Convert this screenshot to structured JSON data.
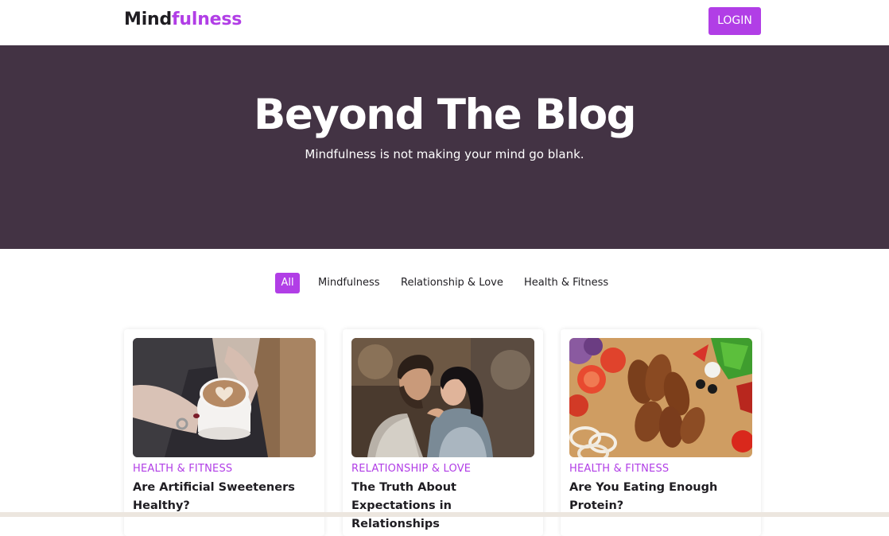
{
  "header": {
    "logo_main": "Mind",
    "logo_accent": "fulness",
    "login_label": "LOGIN"
  },
  "hero": {
    "title": "Beyond The Blog",
    "subtitle": "Mindfulness is not making your mind go blank."
  },
  "filters": [
    {
      "label": "All",
      "active": true
    },
    {
      "label": "Mindfulness",
      "active": false
    },
    {
      "label": "Relationship & Love",
      "active": false
    },
    {
      "label": "Health & Fitness",
      "active": false
    }
  ],
  "cards": [
    {
      "category": "HEALTH & FITNESS",
      "title": "Are Artificial Sweeteners Healthy?",
      "image": "coffee-cup-photo"
    },
    {
      "category": "RELATIONSHIP & LOVE",
      "title": "The Truth About Expectations in Relationships",
      "image": "couple-photo"
    },
    {
      "category": "HEALTH & FITNESS",
      "title": "Are You Eating Enough Protein?",
      "image": "grilled-chicken-photo"
    }
  ],
  "colors": {
    "accent": "#b13ee6",
    "hero_bg": "#433344",
    "text": "#1f1d22"
  }
}
